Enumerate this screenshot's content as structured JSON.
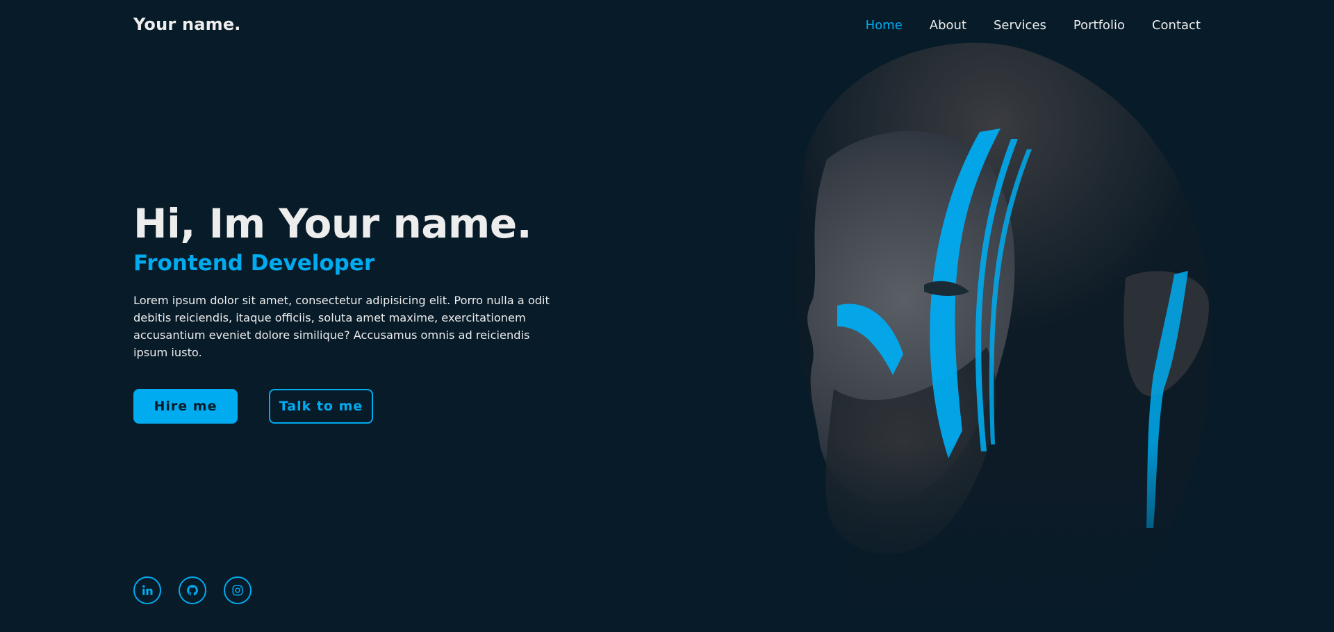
{
  "header": {
    "logo": "Your name.",
    "nav": [
      {
        "label": "Home",
        "active": true
      },
      {
        "label": "About",
        "active": false
      },
      {
        "label": "Services",
        "active": false
      },
      {
        "label": "Portfolio",
        "active": false
      },
      {
        "label": "Contact",
        "active": false
      }
    ]
  },
  "hero": {
    "title": "Hi, Im Your name.",
    "subtitle": "Frontend Developer",
    "description": "Lorem ipsum dolor sit amet, consectetur adipisicing elit. Porro nulla a odit debitis reiciendis, itaque officiis, soluta amet maxime, exercitationem accusantium eveniet dolore similique? Accusamus omnis ad reiciendis ipsum iusto.",
    "primary_button": "Hire me",
    "secondary_button": "Talk to me"
  },
  "social": [
    {
      "icon": "linkedin-icon"
    },
    {
      "icon": "github-icon"
    },
    {
      "icon": "instagram-icon"
    }
  ],
  "colors": {
    "background": "#081b29",
    "accent": "#00abf0",
    "text": "#ededed"
  }
}
